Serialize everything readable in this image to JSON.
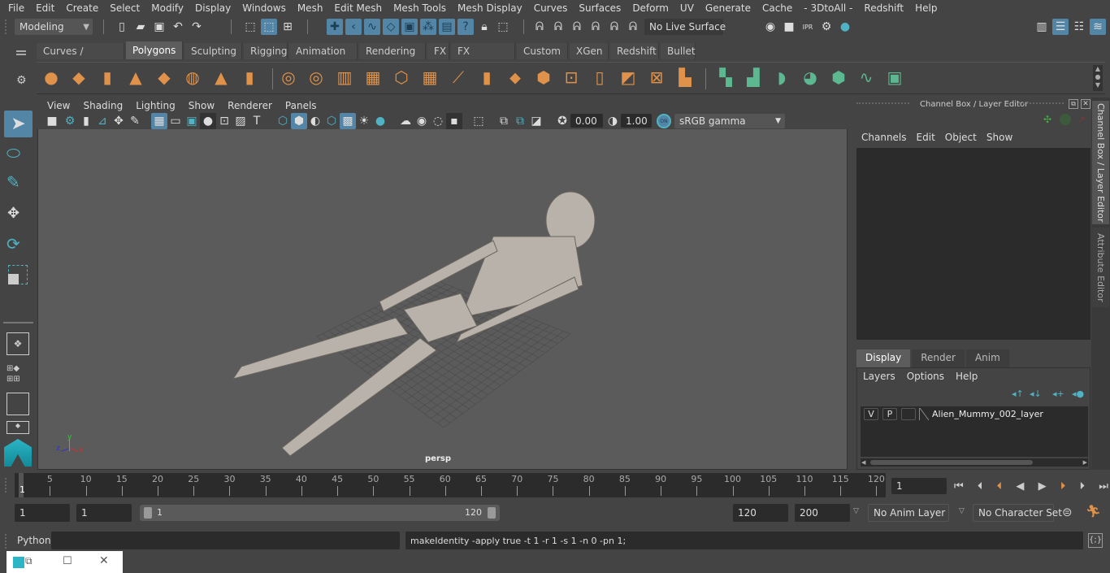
{
  "menubar": [
    "File",
    "Edit",
    "Create",
    "Select",
    "Modify",
    "Display",
    "Windows",
    "Mesh",
    "Edit Mesh",
    "Mesh Tools",
    "Mesh Display",
    "Curves",
    "Surfaces",
    "Deform",
    "UV",
    "Generate",
    "Cache",
    "- 3DtoAll -",
    "Redshift",
    "Help"
  ],
  "statusline": {
    "mode": "Modeling",
    "live_surface": "No Live Surface"
  },
  "shelf": {
    "tabs": [
      "Curves / Surfaces",
      "Polygons",
      "Sculpting",
      "Rigging",
      "Animation",
      "Rendering",
      "FX",
      "FX Caching",
      "Custom",
      "XGen",
      "Redshift",
      "Bullet"
    ],
    "active_tab": "Polygons",
    "tools": [
      "poly-sphere-icon",
      "poly-cube-icon",
      "poly-cylinder-icon",
      "poly-cone-icon",
      "poly-plane-icon",
      "poly-torus-icon",
      "poly-pyramid-icon",
      "poly-pipe-icon",
      "combine-icon",
      "separate-icon",
      "mirror-icon",
      "smooth-icon",
      "extract-icon",
      "boolean-icon",
      "multi-cut-icon",
      "target-weld-icon",
      "bridge-icon",
      "append-polygon-icon",
      "extrude-icon",
      "edge-loop-icon",
      "insert-loop-icon",
      "bevel-icon",
      "quad-draw-icon",
      "triangulate-icon",
      "uv-planar-icon",
      "uv-cylindrical-icon",
      "uv-spherical-icon",
      "uv-auto-icon",
      "uv-contour-icon",
      "uv-editor-icon",
      "uv-unfold-icon"
    ]
  },
  "viewport": {
    "menu": [
      "View",
      "Shading",
      "Lighting",
      "Show",
      "Renderer",
      "Panels"
    ],
    "exposure": "0.00",
    "gamma": "1.00",
    "color_mgmt": "ON",
    "color_space": "sRGB gamma",
    "camera_label": "persp",
    "axis": {
      "x": "x",
      "y": "y",
      "z": "z"
    }
  },
  "channel_box": {
    "title": "Channel Box / Layer Editor",
    "menu": [
      "Channels",
      "Edit",
      "Object",
      "Show"
    ]
  },
  "layer_editor": {
    "tabs": [
      "Display",
      "Render",
      "Anim"
    ],
    "active_tab": "Display",
    "menu": [
      "Layers",
      "Options",
      "Help"
    ],
    "layers": [
      {
        "v": "V",
        "p": "P",
        "name": "Alien_Mummy_002_layer"
      }
    ]
  },
  "side_tabs": [
    "Channel Box / Layer Editor",
    "Attribute Editor"
  ],
  "timeline": {
    "ticks": [
      5,
      10,
      15,
      20,
      25,
      30,
      35,
      40,
      45,
      50,
      55,
      60,
      65,
      70,
      75,
      80,
      85,
      90,
      95,
      100,
      105,
      110,
      115,
      120
    ],
    "current_frame_marker": "1",
    "current_frame": "1"
  },
  "range": {
    "start": "1",
    "playback_start": "1",
    "slider_start": "1",
    "slider_end": "120",
    "playback_end": "120",
    "end": "200",
    "anim_layer": "No Anim Layer",
    "character_set": "No Character Set"
  },
  "command": {
    "language": "Python",
    "input": "",
    "result": "makeIdentity -apply true -t 1 -r 1 -s 1 -n 0 -pn 1;"
  },
  "colors": {
    "accent": "#5285a6",
    "shelf_orange": "#e0924a",
    "shelf_green": "#5cb891",
    "viewport_bg": "#5b5b5b"
  }
}
